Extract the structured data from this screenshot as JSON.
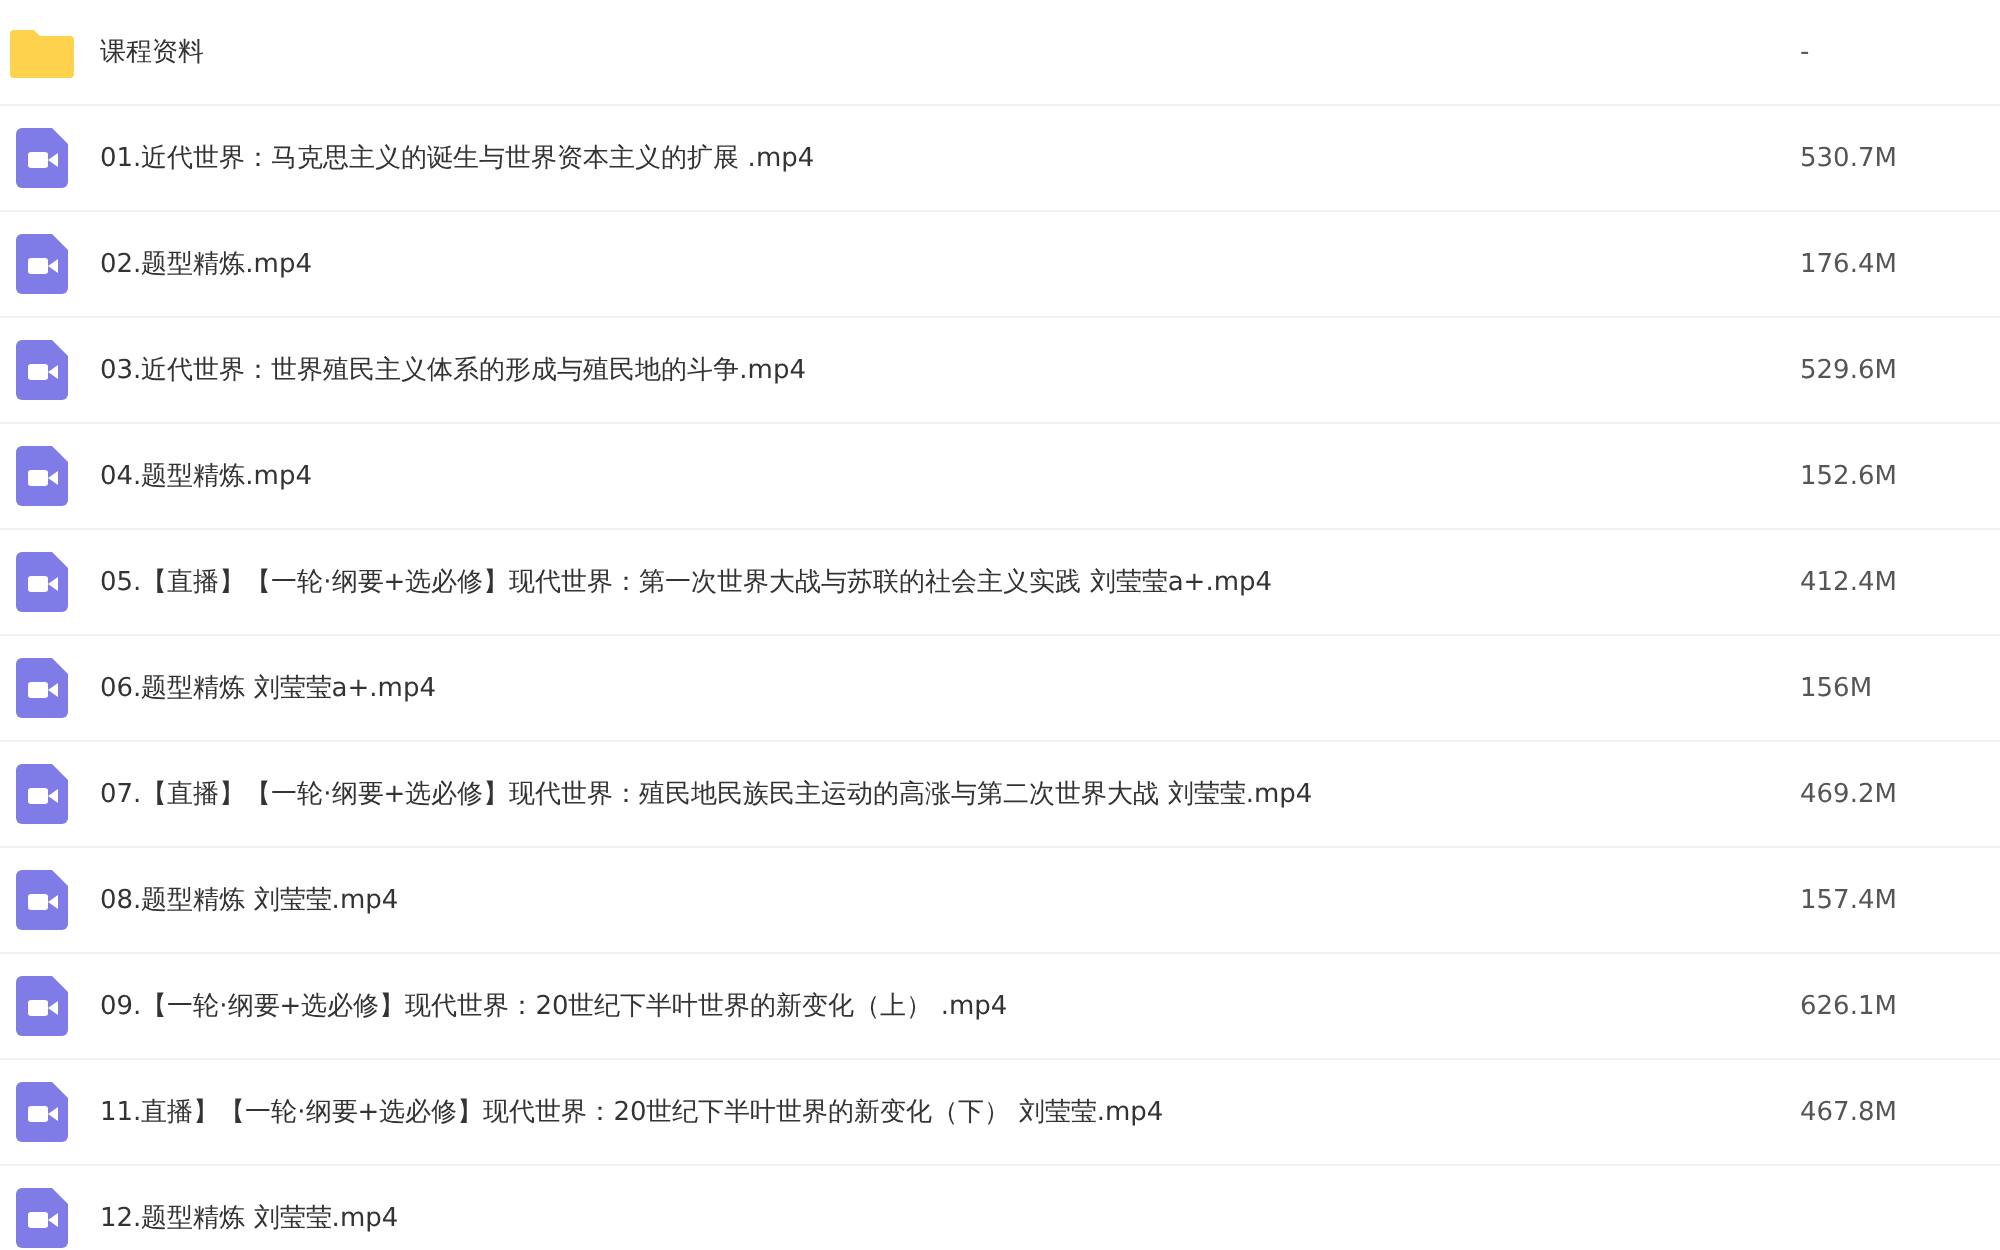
{
  "files": [
    {
      "kind": "folder",
      "name": "课程资料",
      "size": "-"
    },
    {
      "kind": "video",
      "name": "01.近代世界：马克思主义的诞生与世界资本主义的扩展 .mp4",
      "size": "530.7M"
    },
    {
      "kind": "video",
      "name": "02.题型精炼.mp4",
      "size": "176.4M"
    },
    {
      "kind": "video",
      "name": "03.近代世界：世界殖民主义体系的形成与殖民地的斗争.mp4",
      "size": "529.6M"
    },
    {
      "kind": "video",
      "name": "04.题型精炼.mp4",
      "size": "152.6M"
    },
    {
      "kind": "video",
      "name": "05.【直播】【一轮·纲要+选必修】现代世界：第一次世界大战与苏联的社会主义实践 刘莹莹a+.mp4",
      "size": "412.4M"
    },
    {
      "kind": "video",
      "name": "06.题型精炼 刘莹莹a+.mp4",
      "size": "156M"
    },
    {
      "kind": "video",
      "name": "07.【直播】【一轮·纲要+选必修】现代世界：殖民地民族民主运动的高涨与第二次世界大战 刘莹莹.mp4",
      "size": "469.2M"
    },
    {
      "kind": "video",
      "name": "08.题型精炼 刘莹莹.mp4",
      "size": "157.4M"
    },
    {
      "kind": "video",
      "name": "09.【一轮·纲要+选必修】现代世界：20世纪下半叶世界的新变化（上） .mp4",
      "size": "626.1M"
    },
    {
      "kind": "video",
      "name": "11.直播】【一轮·纲要+选必修】现代世界：20世纪下半叶世界的新变化（下） 刘莹莹.mp4",
      "size": "467.8M"
    },
    {
      "kind": "video",
      "name": "12.题型精炼 刘莹莹.mp4"
    }
  ]
}
